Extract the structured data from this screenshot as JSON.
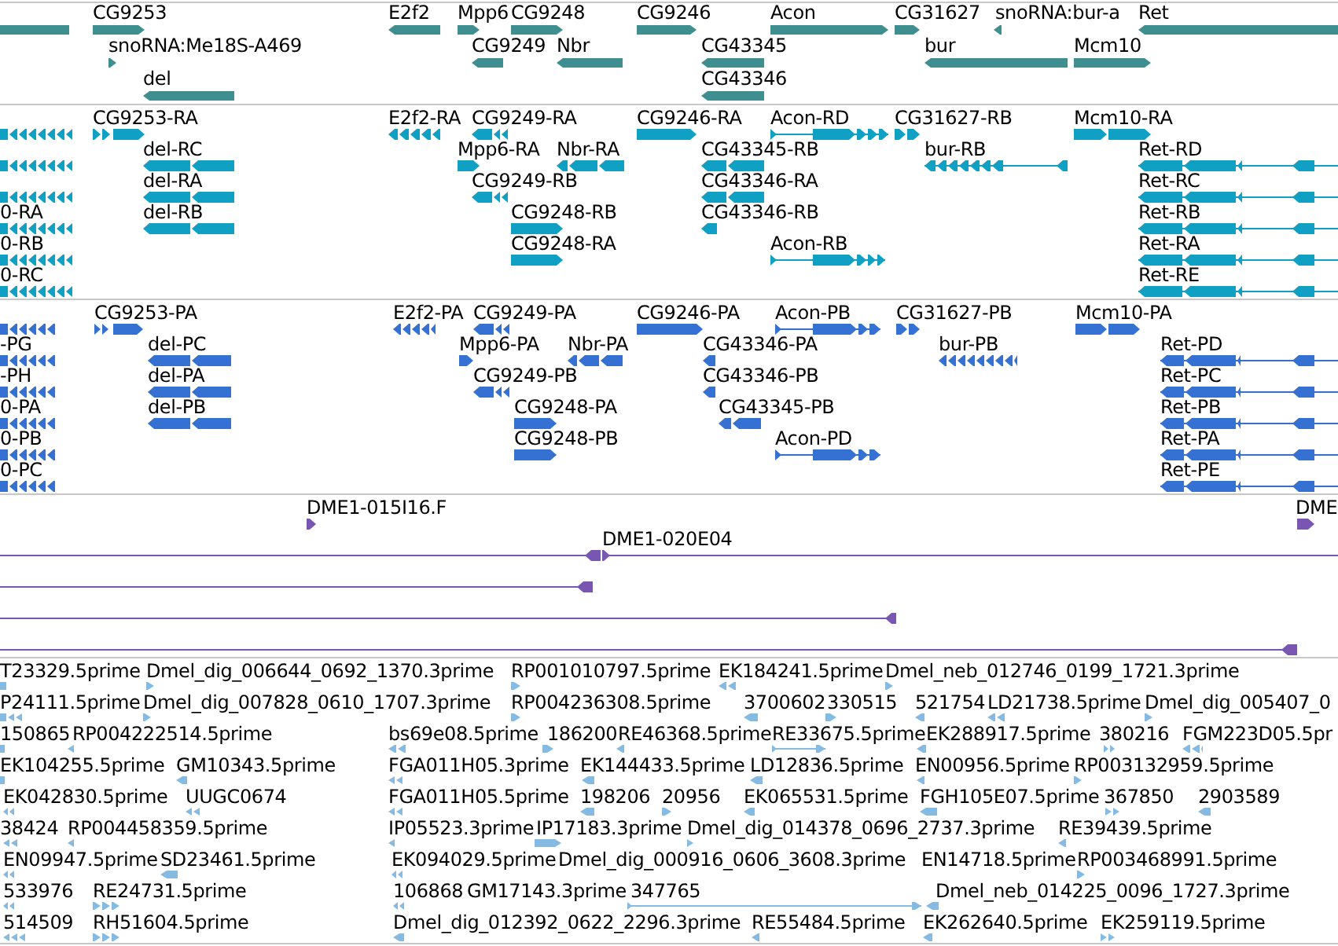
{
  "tracks": [
    {
      "kind": "gene",
      "features": [
        {
          "reverse": true
        },
        {
          "label": "CG9253",
          "reverse": false
        },
        {
          "label": "E2f2",
          "reverse": true
        },
        {
          "label": "Mpp6",
          "reverse": false
        },
        {
          "label": "CG9248",
          "reverse": false
        },
        {
          "label": "CG9246",
          "reverse": false
        },
        {
          "label": "Acon",
          "reverse": false
        },
        {
          "label": "CG31627",
          "reverse": false
        },
        {
          "label": "snoRNA:bur-a",
          "reverse": true
        },
        {
          "label": "Ret",
          "reverse": true
        },
        {
          "label": "snoRNA:Me18S-A469",
          "reverse": false
        },
        {
          "label": "CG9249",
          "reverse": true
        },
        {
          "label": "Nbr",
          "reverse": true
        },
        {
          "label": "CG43345",
          "reverse": true
        },
        {
          "label": "bur",
          "reverse": true
        },
        {
          "label": "Mcm10",
          "reverse": false
        },
        {
          "label": "del",
          "reverse": true
        },
        {
          "label": "CG43346",
          "reverse": true
        }
      ]
    },
    {
      "kind": "transcript",
      "features": [
        {
          "reverse": true
        },
        {
          "label": "CG9253-RA",
          "reverse": false
        },
        {
          "label": "E2f2-RA",
          "reverse": true
        },
        {
          "label": "CG9249-RA",
          "reverse": true
        },
        {
          "label": "CG9246-RA",
          "reverse": false
        },
        {
          "label": "Acon-RD",
          "reverse": false
        },
        {
          "label": "CG31627-RB",
          "reverse": false
        },
        {
          "label": "Mcm10-RA",
          "reverse": false
        },
        {
          "reverse": true
        },
        {
          "label": "del-RC",
          "reverse": true
        },
        {
          "label": "Mpp6-RA",
          "reverse": false
        },
        {
          "label": "Nbr-RA",
          "reverse": true
        },
        {
          "label": "CG43345-RB",
          "reverse": true
        },
        {
          "label": "bur-RB",
          "reverse": true
        },
        {
          "label": "Ret-RD",
          "reverse": true
        },
        {
          "reverse": true
        },
        {
          "label": "del-RA",
          "reverse": true
        },
        {
          "label": "CG9249-RB",
          "reverse": true
        },
        {
          "label": "CG43346-RA",
          "reverse": true
        },
        {
          "label": "Ret-RC",
          "reverse": true
        },
        {
          "label": "0-RA",
          "reverse": true
        },
        {
          "label": "del-RB",
          "reverse": true
        },
        {
          "label": "CG9248-RB",
          "reverse": false
        },
        {
          "label": "CG43346-RB",
          "reverse": true
        },
        {
          "label": "Ret-RB",
          "reverse": true
        },
        {
          "label": "0-RB",
          "reverse": true
        },
        {
          "label": "CG9248-RA",
          "reverse": false
        },
        {
          "label": "Acon-RB",
          "reverse": false
        },
        {
          "label": "Ret-RA",
          "reverse": true
        },
        {
          "label": "0-RC",
          "reverse": true
        },
        {
          "label": "Ret-RE",
          "reverse": true
        }
      ]
    },
    {
      "kind": "protein",
      "features": [
        {
          "reverse": true
        },
        {
          "label": "CG9253-PA",
          "reverse": false
        },
        {
          "label": "E2f2-PA",
          "reverse": true
        },
        {
          "label": "CG9249-PA",
          "reverse": true
        },
        {
          "label": "CG9246-PA",
          "reverse": false
        },
        {
          "label": "Acon-PB",
          "reverse": false
        },
        {
          "label": "CG31627-PB",
          "reverse": false
        },
        {
          "label": "Mcm10-PA",
          "reverse": false
        },
        {
          "label": "-PG",
          "reverse": true
        },
        {
          "label": "del-PC",
          "reverse": true
        },
        {
          "label": "Mpp6-PA",
          "reverse": false
        },
        {
          "label": "Nbr-PA",
          "reverse": true
        },
        {
          "label": "CG43346-PA",
          "reverse": true
        },
        {
          "label": "bur-PB",
          "reverse": true
        },
        {
          "label": "Ret-PD",
          "reverse": true
        },
        {
          "label": "-PH",
          "reverse": true
        },
        {
          "label": "del-PA",
          "reverse": true
        },
        {
          "label": "CG9249-PB",
          "reverse": true
        },
        {
          "label": "CG43346-PB",
          "reverse": true
        },
        {
          "label": "Ret-PC",
          "reverse": true
        },
        {
          "label": "0-PA",
          "reverse": true
        },
        {
          "label": "del-PB",
          "reverse": true
        },
        {
          "label": "CG9248-PA",
          "reverse": false
        },
        {
          "label": "CG43345-PB",
          "reverse": true
        },
        {
          "label": "Ret-PB",
          "reverse": true
        },
        {
          "label": "0-PB",
          "reverse": true
        },
        {
          "label": "CG9248-PB",
          "reverse": false
        },
        {
          "label": "Acon-PD",
          "reverse": false
        },
        {
          "label": "Ret-PA",
          "reverse": true
        },
        {
          "label": "0-PC",
          "reverse": true
        },
        {
          "label": "Ret-PE",
          "reverse": true
        }
      ]
    },
    {
      "kind": "clone",
      "features": [
        {
          "label": "DME1-015I16.F",
          "reverse": false
        },
        {
          "label": "DME",
          "reverse": false
        },
        {
          "reverse": true
        },
        {
          "label": "DME1-020E04",
          "reverse": false
        },
        {
          "reverse": true
        },
        {
          "reverse": true
        },
        {
          "reverse": true
        }
      ]
    },
    {
      "kind": "est",
      "features": [
        {
          "label": "T23329.5prime",
          "reverse": true
        },
        {
          "label": "Dmel_dig_006644_0692_1370.3prime",
          "reverse": false
        },
        {
          "label": "RP001010797.5prime",
          "reverse": false
        },
        {
          "label": "EK184241.5prime",
          "reverse": true
        },
        {
          "label": "Dmel_neb_012746_0199_1721.3prime",
          "reverse": false
        },
        {
          "label": "P24111.5prime",
          "reverse": true
        },
        {
          "label": "Dmel_dig_007828_0610_1707.3prime",
          "reverse": false
        },
        {
          "label": "RP004236308.5prime",
          "reverse": false
        },
        {
          "label": "3700602",
          "reverse": true
        },
        {
          "label": "330515",
          "reverse": false
        },
        {
          "label": "521754",
          "reverse": true
        },
        {
          "label": "LD21738.5prime",
          "reverse": true
        },
        {
          "label": "Dmel_dig_005407_0",
          "reverse": false
        },
        {
          "label": "150865",
          "reverse": true
        },
        {
          "label": "RP004222514.5prime",
          "reverse": true
        },
        {
          "label": "bs69e08.5prime",
          "reverse": true
        },
        {
          "label": "186200",
          "reverse": false
        },
        {
          "label": "RE46368.5prime",
          "reverse": true
        },
        {
          "label": "RE33675.5prime",
          "reverse": false
        },
        {
          "label": "EK288917.5prime",
          "reverse": true
        },
        {
          "label": "380216",
          "reverse": false
        },
        {
          "label": "FGM223D05.5pr",
          "reverse": true
        },
        {
          "label": "EK104255.5prime",
          "reverse": true
        },
        {
          "label": "GM10343.5prime",
          "reverse": true
        },
        {
          "label": "FGA011H05.3prime",
          "reverse": true
        },
        {
          "label": "EK144433.5prime",
          "reverse": true
        },
        {
          "label": "LD12836.5prime",
          "reverse": true
        },
        {
          "label": "EN00956.5prime",
          "reverse": true
        },
        {
          "label": "RP003132959.5prime",
          "reverse": false
        },
        {
          "label": "EK042830.5prime",
          "reverse": true
        },
        {
          "label": "UUGC0674",
          "reverse": true
        },
        {
          "label": "FGA011H05.5prime",
          "reverse": true
        },
        {
          "label": "198206",
          "reverse": true
        },
        {
          "label": "20956",
          "reverse": false
        },
        {
          "label": "EK065531.5prime",
          "reverse": true
        },
        {
          "label": "FGH105E07.5prime",
          "reverse": true
        },
        {
          "label": "367850",
          "reverse": false
        },
        {
          "label": "2903589",
          "reverse": true
        },
        {
          "label": "38424",
          "reverse": true
        },
        {
          "label": "RP004458359.5prime",
          "reverse": true
        },
        {
          "label": "IP05523.3prime",
          "reverse": true
        },
        {
          "label": "IP17183.3prime",
          "reverse": false
        },
        {
          "label": "Dmel_dig_014378_0696_2737.3prime",
          "reverse": false
        },
        {
          "label": "RE39439.5prime",
          "reverse": true
        },
        {
          "label": "EN09947.5prime",
          "reverse": true
        },
        {
          "label": "SD23461.5prime",
          "reverse": true
        },
        {
          "label": "EK094029.5prime",
          "reverse": true
        },
        {
          "label": "Dmel_dig_000916_0606_3608.3prime"
        },
        {
          "label": "EN14718.5prime"
        },
        {
          "label": "RP003468991.5prime",
          "reverse": false
        },
        {
          "label": "533976",
          "reverse": true
        },
        {
          "label": "RE24731.5prime",
          "reverse": false
        },
        {
          "label": "106868",
          "reverse": true
        },
        {
          "label": "GM17143.3prime"
        },
        {
          "label": "347765",
          "reverse": false
        },
        {
          "label": "Dmel_neb_014225_0096_1727.3prime",
          "reverse": true
        },
        {
          "label": "514509",
          "reverse": true
        },
        {
          "label": "RH51604.5prime",
          "reverse": false
        },
        {
          "label": "Dmel_dig_012392_0622_2296.3prime",
          "reverse": true
        },
        {
          "label": "RE55484.5prime",
          "reverse": true
        },
        {
          "label": "EK262640.5prime",
          "reverse": true
        },
        {
          "label": "EK259119.5prime",
          "reverse": false
        }
      ]
    }
  ]
}
